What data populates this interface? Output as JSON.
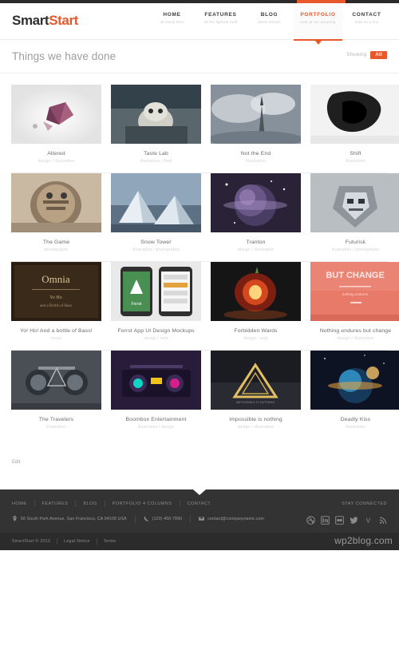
{
  "header": {
    "logo": {
      "part1": "Smart",
      "part2": "Start"
    },
    "nav": [
      {
        "label": "HOME",
        "sub": "all starts here",
        "active": false,
        "name": "nav-item-home"
      },
      {
        "label": "FEATURES",
        "sub": "all the lightest stuff",
        "active": false,
        "name": "nav-item-features"
      },
      {
        "label": "BLOG",
        "sub": "latest stories",
        "active": false,
        "name": "nav-item-blog"
      },
      {
        "label": "PORTFOLIO",
        "sub": "look at our amazing",
        "active": true,
        "name": "nav-item-portfolio"
      },
      {
        "label": "CONTACT",
        "sub": "drop us a line",
        "active": false,
        "name": "nav-item-contact"
      }
    ]
  },
  "page": {
    "title": "Things we have done",
    "showing_label": "Showing",
    "showing_value": "All",
    "edit_label": "Edit"
  },
  "portfolio": {
    "rows": [
      [
        {
          "title": "Altered",
          "sub": "design / illustration",
          "art": "altered"
        },
        {
          "title": "Taste Lab",
          "sub": "illustration / food",
          "art": "tastelab"
        },
        {
          "title": "Not the End",
          "sub": "illustration",
          "art": "nottheend"
        },
        {
          "title": "Shift",
          "sub": "illustration",
          "art": "shift"
        }
      ],
      [
        {
          "title": "The Game",
          "sub": "photography",
          "art": "thegame"
        },
        {
          "title": "Snow Tower",
          "sub": "illustration / photography",
          "art": "snowtower"
        },
        {
          "title": "Tranton",
          "sub": "design / illustration",
          "art": "tranton"
        },
        {
          "title": "Futurisk",
          "sub": "illustration / photography",
          "art": "futurisk"
        }
      ],
      [
        {
          "title": "Yo! Ho! And a bottle of Bass!",
          "sub": "music",
          "art": "yoho"
        },
        {
          "title": "Forrst App UI Design Mockups",
          "sub": "design / web",
          "art": "forrst"
        },
        {
          "title": "Forbidden Wards",
          "sub": "design / web",
          "art": "forbidden"
        },
        {
          "title": "Nothing endures but change",
          "sub": "design / illustration",
          "art": "nothing"
        }
      ],
      [
        {
          "title": "The Travelers",
          "sub": "illustration",
          "art": "travelers"
        },
        {
          "title": "Boombox Entertainment",
          "sub": "illustration / design",
          "art": "boombox"
        },
        {
          "title": "Impossible is nothing",
          "sub": "design / illustration",
          "art": "impossible"
        },
        {
          "title": "Deadly Kiss",
          "sub": "illustration",
          "art": "deadlykiss"
        }
      ]
    ]
  },
  "footer": {
    "nav": [
      {
        "label": "HOME",
        "name": "footer-nav-home"
      },
      {
        "label": "FEATURES",
        "name": "footer-nav-features"
      },
      {
        "label": "BLOG",
        "name": "footer-nav-blog"
      },
      {
        "label": "PORTFOLIO 4 COLUMNS",
        "name": "footer-nav-portfolio-4-columns"
      },
      {
        "label": "CONTACT",
        "name": "footer-nav-contact"
      }
    ],
    "stay_connected": "STAY CONNECTED",
    "contact": {
      "address": "50 South Park Avenue, San Francisco, CA 94108 USA",
      "phone": "(123) 456-7890",
      "email": "contact@companyname.com"
    },
    "social": [
      {
        "name": "social-icon-dribbble",
        "glyph": "dribbble"
      },
      {
        "name": "social-icon-linkedin",
        "glyph": "linkedin"
      },
      {
        "name": "social-icon-flickr",
        "glyph": "flickr"
      },
      {
        "name": "social-icon-twitter",
        "glyph": "twitter"
      },
      {
        "name": "social-icon-vimeo",
        "glyph": "vimeo"
      },
      {
        "name": "social-icon-rss",
        "glyph": "rss"
      }
    ],
    "copyright": "SmartStart © 2012",
    "legal_notice": "Legal Notice",
    "terms": "Terms",
    "watermark": "wp2blog.com"
  },
  "colors": {
    "accent": "#e8582a",
    "footer_bg": "#333333",
    "footer_bottom_bg": "#2b2b2b",
    "title_gray": "#9d9d9d"
  }
}
